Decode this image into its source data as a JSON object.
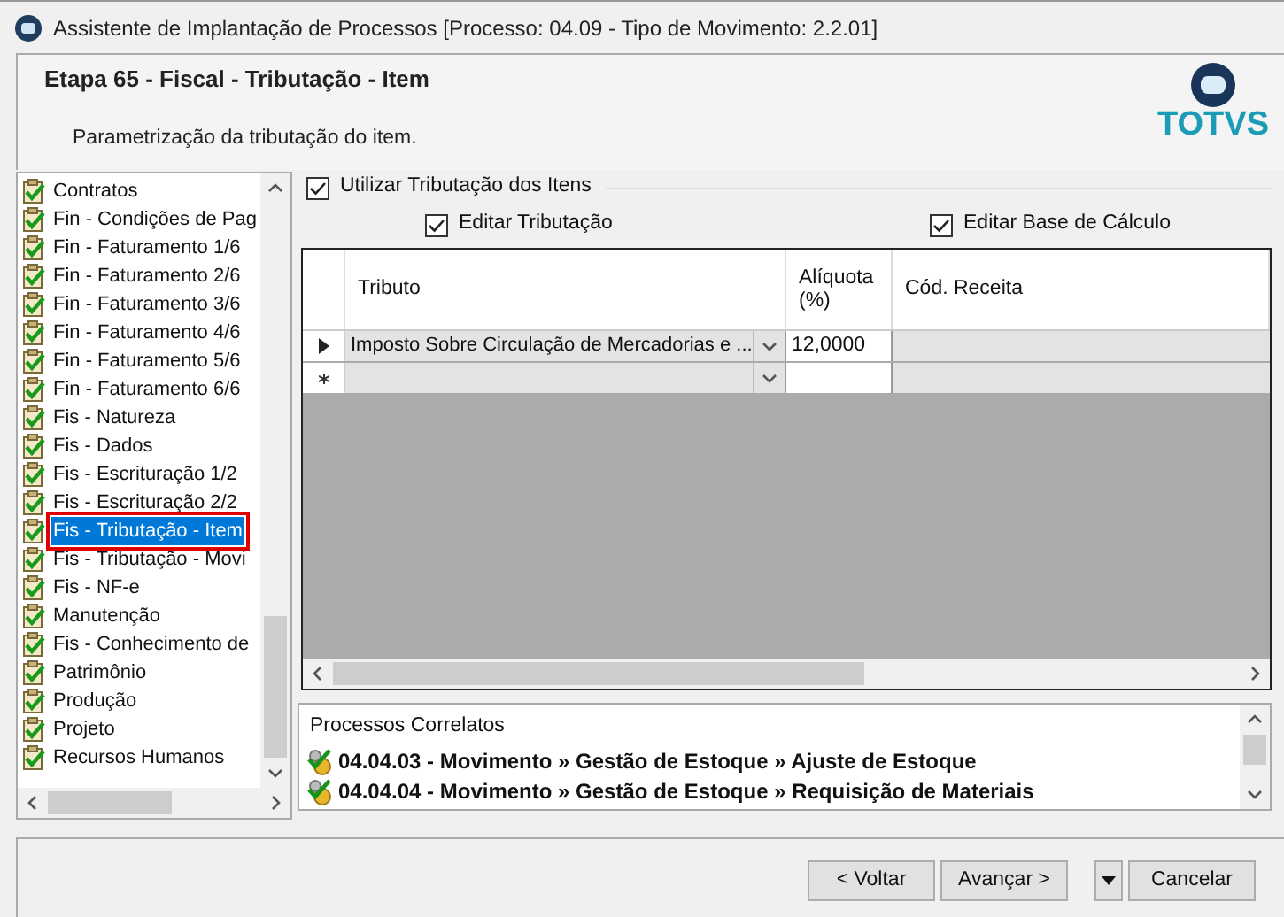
{
  "window": {
    "title": "Assistente de Implantação de Processos [Processo: 04.09 - Tipo de Movimento: 2.2.01]"
  },
  "header": {
    "title": "Etapa 65 - Fiscal - Tributação - Item",
    "subtitle": "Parametrização da tributação do item.",
    "logo": "TOTVS"
  },
  "steps": [
    {
      "label": "Contratos",
      "selected": false
    },
    {
      "label": "Fin - Condições de Pag",
      "selected": false
    },
    {
      "label": "Fin - Faturamento 1/6",
      "selected": false
    },
    {
      "label": "Fin - Faturamento 2/6",
      "selected": false
    },
    {
      "label": "Fin - Faturamento 3/6",
      "selected": false
    },
    {
      "label": "Fin - Faturamento 4/6",
      "selected": false
    },
    {
      "label": "Fin - Faturamento 5/6",
      "selected": false
    },
    {
      "label": "Fin - Faturamento 6/6",
      "selected": false
    },
    {
      "label": "Fis - Natureza",
      "selected": false
    },
    {
      "label": "Fis - Dados",
      "selected": false
    },
    {
      "label": "Fis - Escrituração 1/2",
      "selected": false
    },
    {
      "label": "Fis - Escrituração 2/2",
      "selected": false
    },
    {
      "label": "Fis - Tributação - Item",
      "selected": true
    },
    {
      "label": "Fis - Tributação - Movi",
      "selected": false
    },
    {
      "label": "Fis - NF-e",
      "selected": false
    },
    {
      "label": "Manutenção",
      "selected": false
    },
    {
      "label": "Fis - Conhecimento de",
      "selected": false
    },
    {
      "label": "Patrimônio",
      "selected": false
    },
    {
      "label": "Produção",
      "selected": false
    },
    {
      "label": "Projeto",
      "selected": false
    },
    {
      "label": "Recursos Humanos",
      "selected": false
    }
  ],
  "use_item_taxation": {
    "label": "Utilizar Tributação dos Itens",
    "checked": true
  },
  "edit_options": [
    {
      "label": "Editar Tributação",
      "checked": true
    },
    {
      "label": "Editar Base de Cálculo",
      "checked": true
    }
  ],
  "table": {
    "columns": [
      "Tributo",
      "Alíquota (%)",
      "Cód. Receita"
    ],
    "rows": [
      {
        "kind": "current",
        "tributo": "Imposto Sobre Circulação de Mercadorias e ...",
        "aliquota": "12,0000"
      },
      {
        "kind": "new",
        "tributo": "",
        "aliquota": ""
      }
    ]
  },
  "related": {
    "title": "Processos Correlatos",
    "items": [
      "04.04.03 - Movimento » Gestão de Estoque » Ajuste de Estoque",
      "04.04.04 - Movimento » Gestão de Estoque » Requisição de Materiais"
    ]
  },
  "buttons": {
    "back": "< Voltar",
    "next": "Avançar >",
    "cancel": "Cancelar"
  }
}
